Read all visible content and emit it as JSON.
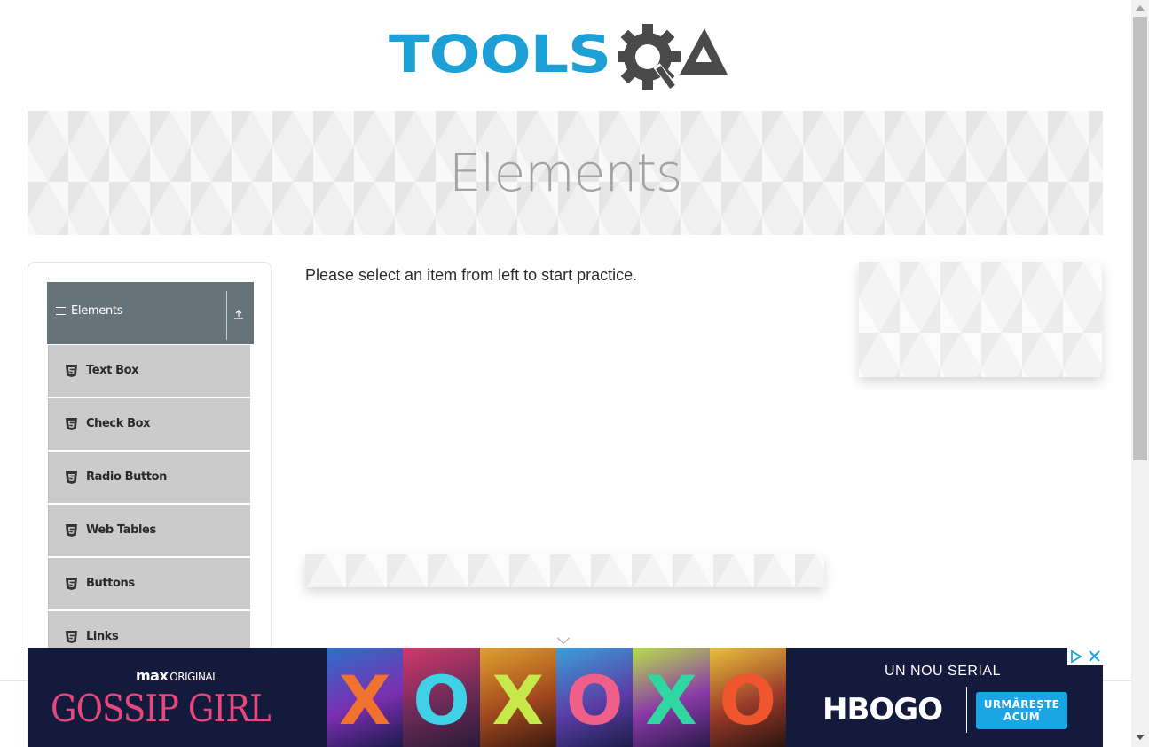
{
  "logo": {
    "wordmark": "TOOLS",
    "suffix": "QA"
  },
  "banner": {
    "title": "Elements"
  },
  "sidebar": {
    "group": {
      "label": "Elements",
      "menu_icon": "hamburger-icon",
      "collapse_icon": "collapse-arrow-icon"
    },
    "items": [
      {
        "label": "Text Box",
        "icon": "html5-icon"
      },
      {
        "label": "Check Box",
        "icon": "html5-icon"
      },
      {
        "label": "Radio Button",
        "icon": "html5-icon"
      },
      {
        "label": "Web Tables",
        "icon": "html5-icon"
      },
      {
        "label": "Buttons",
        "icon": "html5-icon"
      },
      {
        "label": "Links",
        "icon": "html5-icon"
      }
    ]
  },
  "main": {
    "intro_text": "Please select an item from left to start practice."
  },
  "bottom_ad": {
    "brand": "max",
    "brand_suffix": "ORIGINAL",
    "show_title": "GOSSIP GIRL",
    "photo_marks": [
      "X",
      "O",
      "X",
      "O",
      "X",
      "O"
    ],
    "tagline": "UN NOU SERIAL",
    "service": "HBOGO",
    "cta_line1": "URMĂREȘTE",
    "cta_line2": "ACUM",
    "close_icon": "close-icon",
    "adchoices_icon": "adchoices-icon"
  },
  "colors": {
    "brand_blue": "#1ca0d6",
    "logo_gray": "#4a4a4a",
    "sidebar_header": "#67737b",
    "menu_item_bg": "#cbcbcb",
    "ad_background": "#141a3c",
    "ad_pink": "#e8477b",
    "ad_cta": "#1aa6e4"
  }
}
